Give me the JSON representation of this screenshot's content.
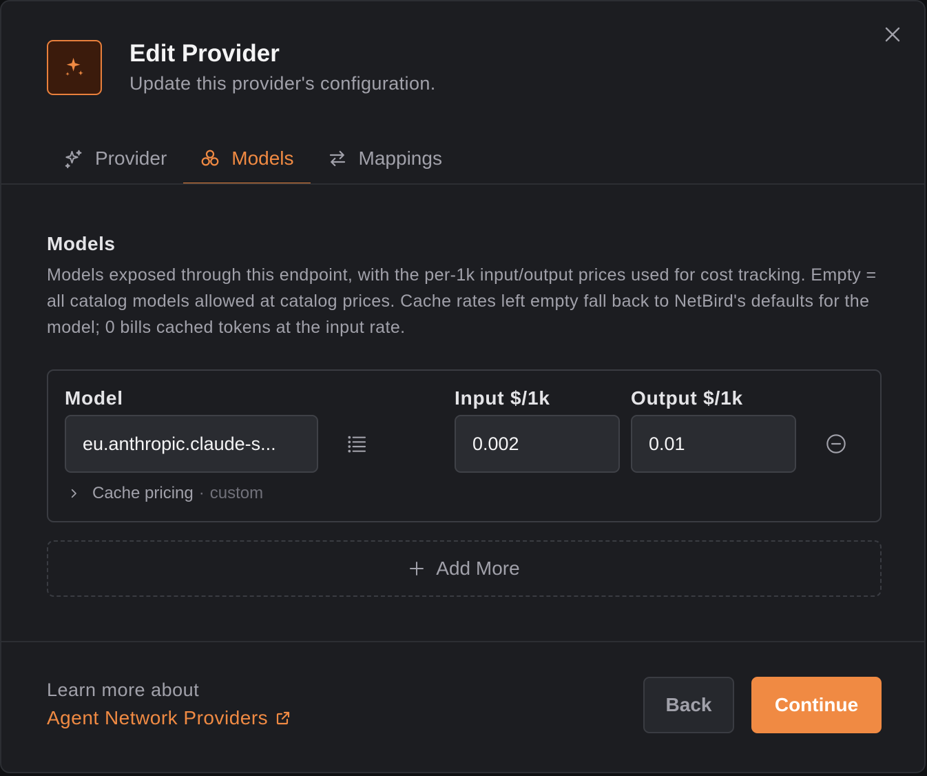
{
  "dialog": {
    "title": "Edit Provider",
    "subtitle": "Update this provider's configuration.",
    "icon": "sparkles-icon",
    "accent_color": "#f08a43"
  },
  "tabs": [
    {
      "label": "Provider",
      "icon": "sparkles-icon",
      "active": false
    },
    {
      "label": "Models",
      "icon": "boxes-icon",
      "active": true
    },
    {
      "label": "Mappings",
      "icon": "arrows-left-right-icon",
      "active": false
    }
  ],
  "models_section": {
    "title": "Models",
    "description": "Models exposed through this endpoint, with the per-1k input/output prices used for cost tracking. Empty = all catalog models allowed at catalog prices. Cache rates left empty fall back to NetBird's defaults for the model; 0 bills cached tokens at the input rate.",
    "columns": {
      "model": "Model",
      "input": "Input $/1k",
      "output": "Output $/1k"
    },
    "rows": [
      {
        "model": "eu.anthropic.claude-s...",
        "input_price": "0.002",
        "output_price": "0.01",
        "cache_label": "Cache pricing",
        "cache_separator": "·",
        "cache_tag": "custom"
      }
    ],
    "add_more_label": "Add More"
  },
  "footer": {
    "learn_more": "Learn more about",
    "link_text": "Agent Network Providers",
    "back_label": "Back",
    "continue_label": "Continue"
  }
}
